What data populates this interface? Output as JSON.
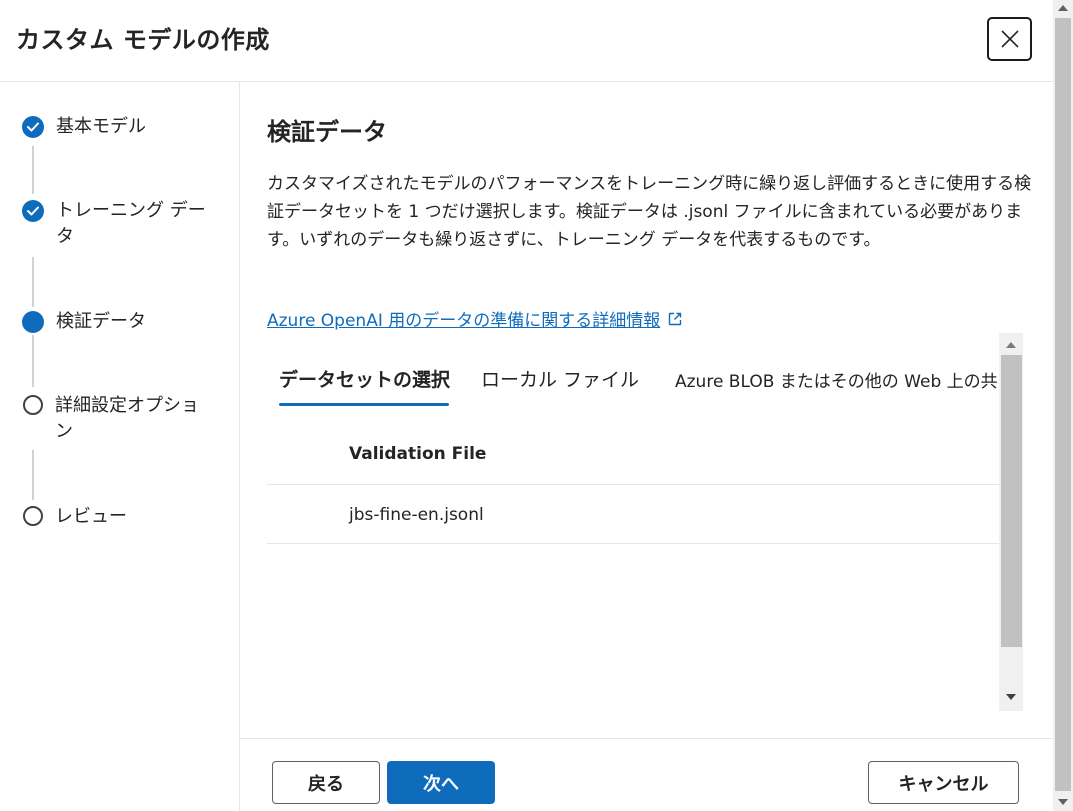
{
  "dialog": {
    "title": "カスタム モデルの作成",
    "close_icon": "close-icon"
  },
  "stepper": {
    "steps": [
      {
        "label": "基本モデル",
        "state": "completed"
      },
      {
        "label": "トレーニング データ",
        "state": "completed"
      },
      {
        "label": "検証データ",
        "state": "current"
      },
      {
        "label": "詳細設定オプション",
        "state": "pending"
      },
      {
        "label": "レビュー",
        "state": "pending"
      }
    ]
  },
  "main": {
    "title": "検証データ",
    "description": "カスタマイズされたモデルのパフォーマンスをトレーニング時に繰り返し評価するときに使用する検証データセットを 1 つだけ選択します。検証データは .jsonl ファイルに含まれている必要があります。いずれのデータも繰り返さずに、トレーニング データを代表するものです。",
    "learn_more_link": "Azure OpenAI 用のデータの準備に関する詳細情報",
    "tabs": [
      {
        "label": "データセットの選択",
        "active": true
      },
      {
        "label": "ローカル ファイル",
        "active": false
      },
      {
        "label": "Azure BLOB またはその他の Web 上の共",
        "active": false
      }
    ],
    "grid": {
      "column_header": "Validation File",
      "rows": [
        "jbs-fine-en.jsonl"
      ]
    }
  },
  "footer": {
    "back_label": "戻る",
    "next_label": "次へ",
    "cancel_label": "キャンセル"
  },
  "colors": {
    "accent": "#0f6cbd",
    "text": "#242424",
    "divider": "#e6e6e6"
  }
}
